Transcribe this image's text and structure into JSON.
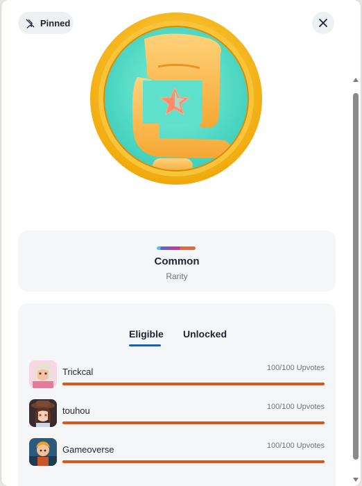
{
  "header": {
    "pinned_label": "Pinned",
    "pinned_icon": "pin-off-icon",
    "close_icon": "close-icon"
  },
  "badge": {
    "image": "hands-framing-star-medal",
    "ring_color": "#f2b21a",
    "inner_color": "#53dcc6"
  },
  "rarity": {
    "name": "Common",
    "subtitle": "Rarity"
  },
  "tabs": [
    {
      "label": "Eligible",
      "active": true
    },
    {
      "label": "Unlocked",
      "active": false
    }
  ],
  "games": [
    {
      "name": "Trickcal",
      "upvotes_text": "100/100 Upvotes",
      "progress": 1.0,
      "avatar": "trickcal-avatar"
    },
    {
      "name": "touhou",
      "upvotes_text": "100/100 Upvotes",
      "progress": 1.0,
      "avatar": "touhou-avatar"
    },
    {
      "name": "Gameoverse",
      "upvotes_text": "100/100 Upvotes",
      "progress": 1.0,
      "avatar": "gameoverse-avatar"
    }
  ],
  "colors": {
    "accent_tab": "#1f5ea8",
    "progress": "#d9571b"
  }
}
